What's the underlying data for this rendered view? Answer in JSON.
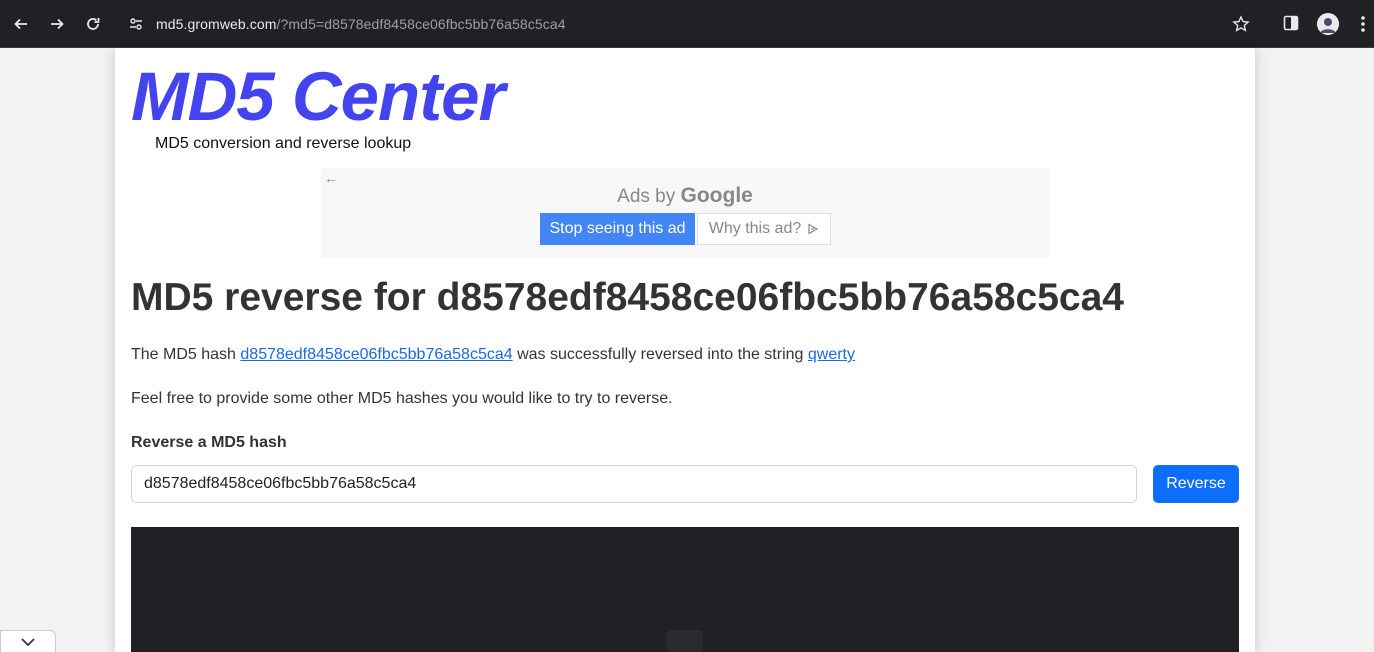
{
  "browser": {
    "url_host": "md5.gromweb.com",
    "url_path": "/?md5=d8578edf8458ce06fbc5bb76a58c5ca4"
  },
  "site": {
    "logo": "MD5 Center",
    "tagline": "MD5 conversion and reverse lookup"
  },
  "ad": {
    "back_arrow": "←",
    "ads_by": "Ads by",
    "google": "Google",
    "stop_label": "Stop seeing this ad",
    "why_label": "Why this ad?"
  },
  "main": {
    "heading": "MD5 reverse for d8578edf8458ce06fbc5bb76a58c5ca4",
    "result_prefix": "The MD5 hash ",
    "result_hash": "d8578edf8458ce06fbc5bb76a58c5ca4",
    "result_middle": " was successfully reversed into the string ",
    "result_string": "qwerty",
    "hint": "Feel free to provide some other MD5 hashes you would like to try to reverse.",
    "form_label": "Reverse a MD5 hash",
    "input_value": "d8578edf8458ce06fbc5bb76a58c5ca4",
    "button_label": "Reverse"
  },
  "colors": {
    "logo": "#4444ee",
    "button": "#0d6efd",
    "link": "#1a6be0"
  }
}
